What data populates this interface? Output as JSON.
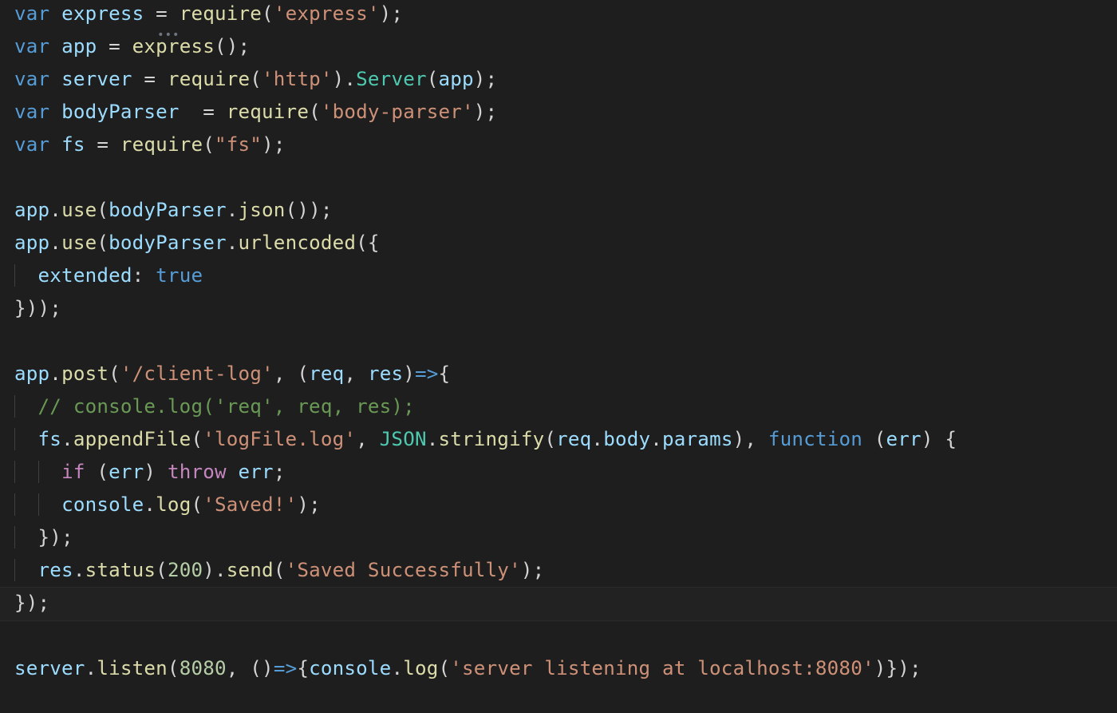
{
  "language": "javascript",
  "editor": "vscode-dark",
  "code": {
    "lines": [
      "var express = require('express');",
      "var app = express();",
      "var server = require('http').Server(app);",
      "var bodyParser  = require('body-parser');",
      "var fs = require(\"fs\");",
      "",
      "app.use(bodyParser.json());",
      "app.use(bodyParser.urlencoded({",
      "  extended: true",
      "}));",
      "",
      "app.post('/client-log', (req, res)=>{",
      "  // console.log('req', req, res);",
      "  fs.appendFile('logFile.log', JSON.stringify(req.body.params), function (err) {",
      "    if (err) throw err;",
      "    console.log('Saved!');",
      "  });",
      "  res.status(200).send('Saved Successfully');",
      "});",
      "",
      "server.listen(8080, ()=>{console.log('server listening at localhost:8080')});"
    ],
    "tokens": {
      "keywords": [
        "var",
        "function",
        "true"
      ],
      "control_flow": [
        "if",
        "throw"
      ],
      "strings": [
        "'express'",
        "'http'",
        "'body-parser'",
        "\"fs\"",
        "'/client-log'",
        "'req'",
        "'logFile.log'",
        "'Saved!'",
        "'Saved Successfully'",
        "'server listening at localhost:8080'"
      ],
      "numbers": [
        200,
        8080
      ],
      "classes": [
        "Server",
        "JSON"
      ],
      "functions": [
        "require",
        "express",
        "use",
        "json",
        "urlencoded",
        "post",
        "log",
        "appendFile",
        "stringify",
        "status",
        "send",
        "listen"
      ],
      "identifiers": [
        "express",
        "app",
        "server",
        "bodyParser",
        "fs",
        "req",
        "res",
        "console",
        "err",
        "body",
        "params",
        "extended"
      ],
      "comments": [
        "// console.log('req', req, res);"
      ]
    },
    "indent_size": 2,
    "highlight_line_index": 18
  }
}
